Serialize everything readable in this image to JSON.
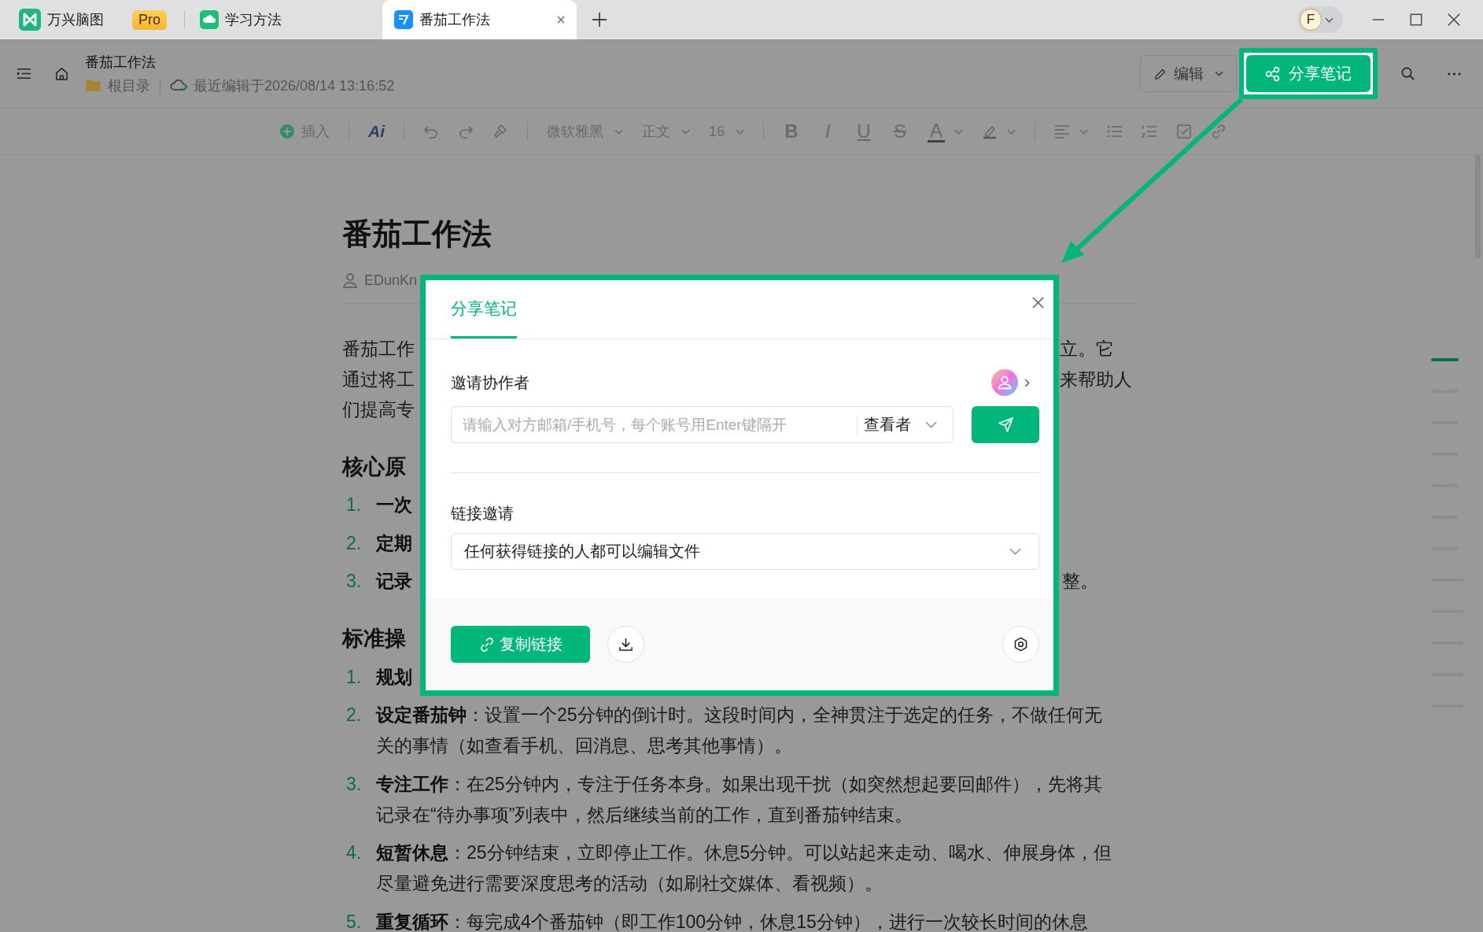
{
  "tabs": [
    {
      "kind": "app",
      "label": "万兴脑图",
      "badge": "Pro",
      "selected": false
    },
    {
      "kind": "cloud",
      "label": "学习方法",
      "selected": false
    },
    {
      "kind": "note",
      "label": "番茄工作法",
      "selected": true
    }
  ],
  "account": {
    "initial": "F"
  },
  "header": {
    "title": "番茄工作法",
    "folder": "根目录",
    "saved": "最近编辑于2026/08/14 13:16:52",
    "edit": "编辑",
    "share": "分享笔记"
  },
  "toolbar": {
    "insert": "插入",
    "ai": "Ai",
    "font": "微软雅黑",
    "style": "正文",
    "size": "16",
    "marks": [
      {
        "kind": "bold",
        "text": "B"
      },
      {
        "kind": "italic",
        "text": "I"
      },
      {
        "kind": "underline",
        "text": "U"
      },
      {
        "kind": "strike",
        "text": "S"
      },
      {
        "kind": "color",
        "text": "A"
      }
    ]
  },
  "document": {
    "title": "番茄工作法",
    "author": "EDunKn",
    "blocks": [
      {
        "kind": "line",
        "left": "番茄工作",
        "right": "立。它"
      },
      {
        "kind": "line",
        "left": "通过将工",
        "right": "来帮助人"
      },
      {
        "kind": "line",
        "left": "们提高专"
      },
      {
        "kind": "heading",
        "text": "核心原"
      },
      {
        "kind": "item",
        "number": "1.",
        "lead": "一次"
      },
      {
        "kind": "item",
        "number": "2.",
        "lead": "定期"
      },
      {
        "kind": "item",
        "number": "3.",
        "lead": "记录",
        "right": "整。"
      },
      {
        "kind": "heading",
        "text": "标准操"
      },
      {
        "kind": "item",
        "number": "1.",
        "lead": "规划"
      },
      {
        "kind": "item",
        "number": "2.",
        "lead": "设定番茄钟",
        "text": "：设置一个25分钟的倒计时。这段时间内，全神贯注于选定的任务，不做任何无关的事情（如查看手机、回消息、思考其他事情）。"
      },
      {
        "kind": "item",
        "number": "3.",
        "lead": "专注工作",
        "text": "：在25分钟内，专注于任务本身。如果出现干扰（如突然想起要回邮件），先将其记录在“待办事项”列表中，然后继续当前的工作，直到番茄钟结束。"
      },
      {
        "kind": "item",
        "number": "4.",
        "lead": "短暂休息",
        "text": "：25分钟结束，立即停止工作。休息5分钟。可以站起来走动、喝水、伸展身体，但尽量避免进行需要深度思考的活动（如刷社交媒体、看视频）。"
      },
      {
        "kind": "item",
        "number": "5.",
        "lead": "重复循环",
        "text": "：每完成4个番茄钟（即工作100分钟，休息15分钟），进行一次较长时间的休息"
      }
    ]
  },
  "outline": [
    {
      "selected": true
    },
    {
      "selected": false
    },
    {
      "selected": false
    },
    {
      "selected": false
    },
    {
      "selected": false
    },
    {
      "selected": false
    },
    {
      "selected": false
    },
    {
      "selected": false
    },
    {
      "selected": false
    },
    {
      "selected": false
    },
    {
      "selected": false
    },
    {
      "selected": false
    }
  ],
  "dialog": {
    "tab": {
      "label": "分享笔记",
      "selected": true
    },
    "invite_label": "邀请协作者",
    "invite_placeholder": "请输入对方邮箱/手机号，每个账号用Enter键隔开",
    "role": "查看者",
    "link_label": "链接邀请",
    "link_permission": "任何获得链接的人都可以编辑文件",
    "copy_button": "复制链接"
  }
}
